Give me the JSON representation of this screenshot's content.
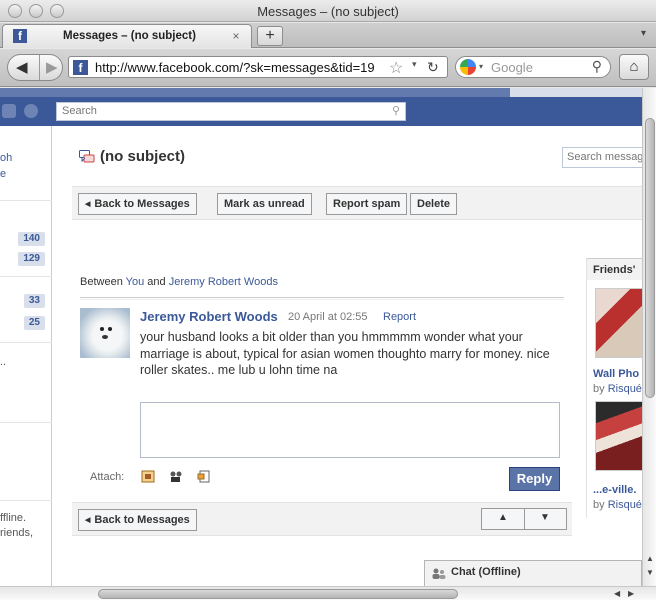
{
  "window": {
    "title": "Messages – (no subject)"
  },
  "tabs": [
    {
      "label": "Messages – (no subject)",
      "favicon": "f"
    }
  ],
  "navbar": {
    "url": "http://www.facebook.com/?sk=messages&tid=19",
    "favicon": "f",
    "search_placeholder": "Google"
  },
  "fb_header": {
    "search_placeholder": "Search"
  },
  "left_col": {
    "items": [
      {
        "label": "oh"
      },
      {
        "label": "e"
      }
    ],
    "counts": [
      "140",
      "129",
      "33",
      "25"
    ],
    "snippets": [
      "..",
      "ffline.",
      "riends,"
    ]
  },
  "message_thread": {
    "subject": "(no subject)",
    "search_placeholder": "Search messages",
    "toolbar": {
      "back": "Back to Messages",
      "mark_unread": "Mark as unread",
      "report_spam": "Report spam",
      "delete": "Delete"
    },
    "between_prefix": "Between",
    "participant_you": "You",
    "between_and": "and",
    "participant_other": "Jeremy Robert Woods",
    "message": {
      "author": "Jeremy Robert Woods",
      "date": "20 April at 02:55",
      "report": "Report",
      "body": "your husband looks a bit older than you hmmmmm wonder what your marriage is about, typical for asian women thoughto marry for money. nice roller skates.. me lub u lohn time na"
    },
    "attach_label": "Attach:",
    "reply_label": "Reply",
    "bottom_back": "Back to Messages"
  },
  "right_col": {
    "heading": "Friends'",
    "items": [
      {
        "title": "Wall Pho",
        "by": "by",
        "owner": "Risqué"
      },
      {
        "title": "...e-ville.",
        "by": "by",
        "owner": "Risqué"
      }
    ]
  },
  "chat": {
    "label": "Chat (Offline)"
  },
  "colors": {
    "fb_blue": "#3b5998",
    "link": "#3b5998"
  }
}
